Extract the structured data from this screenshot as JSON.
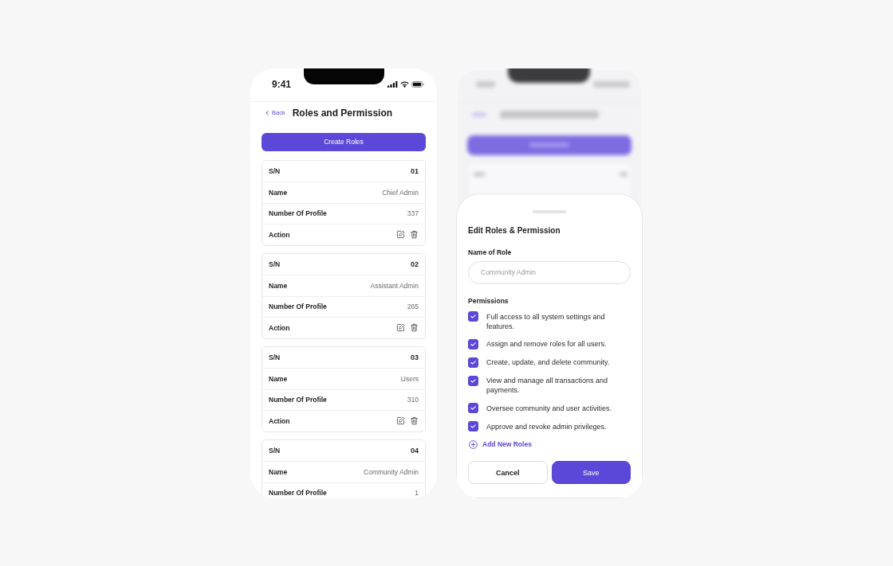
{
  "list_screen": {
    "status_bar": {
      "time": "9:41"
    },
    "header": {
      "back": "Back",
      "title": "Roles and Permission"
    },
    "create_button": "Create Roles",
    "roles": [
      {
        "rows": [
          {
            "kind": "sn",
            "label": "S/N",
            "value": "01"
          },
          {
            "kind": "field",
            "label": "Name",
            "value": "Chief Admin"
          },
          {
            "kind": "field",
            "label": "Number Of Profile",
            "value": "337"
          },
          {
            "kind": "actions",
            "label": "Action"
          }
        ]
      },
      {
        "rows": [
          {
            "kind": "sn",
            "label": "S/N",
            "value": "02"
          },
          {
            "kind": "field",
            "label": "Name",
            "value": "Assistant Admin"
          },
          {
            "kind": "field",
            "label": "Number Of Profile",
            "value": "265"
          },
          {
            "kind": "actions",
            "label": "Action"
          }
        ]
      },
      {
        "rows": [
          {
            "kind": "sn",
            "label": "S/N",
            "value": "03"
          },
          {
            "kind": "field",
            "label": "Name",
            "value": "Users"
          },
          {
            "kind": "field",
            "label": "Number Of Profile",
            "value": "310"
          },
          {
            "kind": "actions",
            "label": "Action"
          }
        ]
      },
      {
        "rows": [
          {
            "kind": "sn",
            "label": "S/N",
            "value": "04"
          },
          {
            "kind": "field",
            "label": "Name",
            "value": "Community Admin"
          },
          {
            "kind": "field",
            "label": "Number Of Profile",
            "value": "1"
          }
        ]
      }
    ]
  },
  "edit_sheet": {
    "title": "Edit Roles & Permission",
    "role_field": {
      "label": "Name of Role",
      "placeholder": "Community Admin"
    },
    "permissions": {
      "label": "Permissions",
      "items": [
        {
          "text": "Full access to all system settings and features.",
          "checked": true
        },
        {
          "text": "Assign and remove roles for all users.",
          "checked": true
        },
        {
          "text": "Create, update, and delete community.",
          "checked": true
        },
        {
          "text": "View and manage all transactions and payments.",
          "checked": true
        },
        {
          "text": "Oversee community and user activities.",
          "checked": true
        },
        {
          "text": "Approve and revoke admin privileges.",
          "checked": true
        }
      ]
    },
    "add_link": "Add New Roles",
    "buttons": [
      {
        "kind": "secondary",
        "label": "Cancel"
      },
      {
        "kind": "primary",
        "label": "Save"
      }
    ]
  }
}
